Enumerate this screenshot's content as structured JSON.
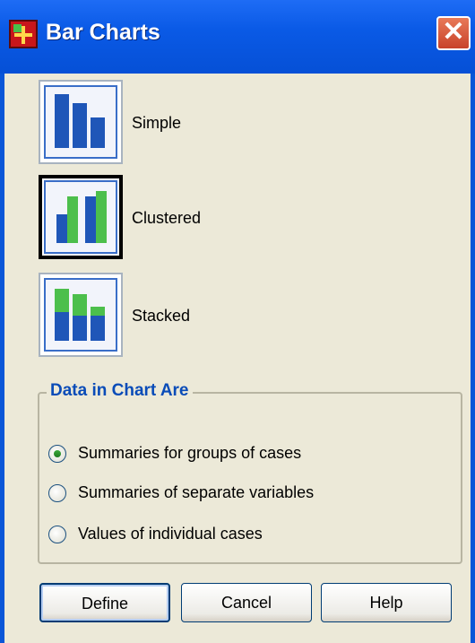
{
  "window": {
    "title": "Bar Charts",
    "close_glyph": "✕"
  },
  "chart_types": [
    {
      "label": "Simple",
      "selected": false
    },
    {
      "label": "Clustered",
      "selected": true
    },
    {
      "label": "Stacked",
      "selected": false
    }
  ],
  "data_group": {
    "title": "Data in Chart Are",
    "options": [
      {
        "label": "Summaries for groups of cases",
        "selected": true
      },
      {
        "label": "Summaries of separate variables",
        "selected": false
      },
      {
        "label": "Values of individual cases",
        "selected": false
      }
    ]
  },
  "buttons": {
    "define": "Define",
    "cancel": "Cancel",
    "help": "Help"
  },
  "colors": {
    "title_bar": "#0a56d8",
    "bar_blue": "#1f56b8",
    "bar_green": "#4cbf4c",
    "group_title": "#0a4cb8"
  }
}
